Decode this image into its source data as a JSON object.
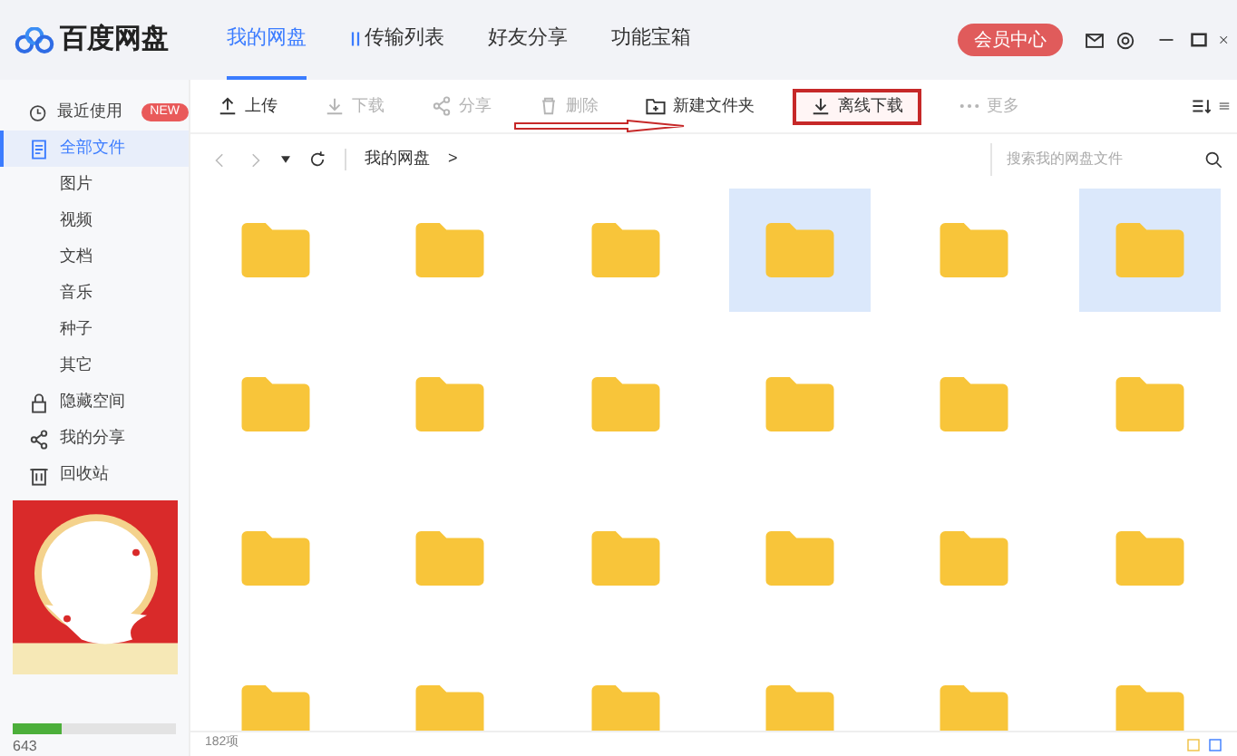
{
  "app": {
    "name": "百度网盘"
  },
  "nav_tabs": [
    {
      "label": "我的网盘",
      "selected": true,
      "kind": "plain"
    },
    {
      "label": "传输列表",
      "selected": false,
      "kind": "transfer"
    },
    {
      "label": "好友分享",
      "selected": false,
      "kind": "plain"
    },
    {
      "label": "功能宝箱",
      "selected": false,
      "kind": "plain"
    }
  ],
  "vip_button": "会员中心",
  "sidebar": {
    "items": [
      {
        "label": "最近使用",
        "kind": "recent",
        "badge": "NEW",
        "selected": false
      },
      {
        "label": "全部文件",
        "kind": "all",
        "selected": true
      },
      {
        "label": "图片",
        "kind": "sub",
        "selected": false
      },
      {
        "label": "视频",
        "kind": "sub",
        "selected": false
      },
      {
        "label": "文档",
        "kind": "sub",
        "selected": false
      },
      {
        "label": "音乐",
        "kind": "sub",
        "selected": false
      },
      {
        "label": "种子",
        "kind": "sub",
        "selected": false
      },
      {
        "label": "其它",
        "kind": "sub",
        "selected": false
      },
      {
        "label": "隐藏空间",
        "kind": "lock",
        "selected": false
      },
      {
        "label": "我的分享",
        "kind": "share",
        "selected": false
      },
      {
        "label": "回收站",
        "kind": "trash",
        "selected": false
      }
    ],
    "storage": {
      "level": 0.3,
      "text": "643"
    }
  },
  "toolbar": [
    {
      "label": "上传",
      "kind": "upload",
      "disabled": false,
      "highlighted": false
    },
    {
      "label": "下载",
      "kind": "download",
      "disabled": true,
      "highlighted": false
    },
    {
      "label": "分享",
      "kind": "share",
      "disabled": true,
      "highlighted": false
    },
    {
      "label": "删除",
      "kind": "delete",
      "disabled": true,
      "highlighted": false
    },
    {
      "label": "新建文件夹",
      "kind": "folder",
      "disabled": false,
      "highlighted": false
    },
    {
      "label": "离线下载",
      "kind": "download",
      "disabled": false,
      "highlighted": true
    },
    {
      "label": "更多",
      "kind": "more",
      "disabled": true,
      "highlighted": false
    }
  ],
  "breadcrumb": {
    "path": "我的网盘",
    "separator": ">"
  },
  "search": {
    "placeholder": "搜索我的网盘文件"
  },
  "folders": [
    {
      "selected": false
    },
    {
      "selected": false
    },
    {
      "selected": false
    },
    {
      "selected": true
    },
    {
      "selected": false
    },
    {
      "selected": true
    },
    {
      "selected": false
    },
    {
      "selected": false
    },
    {
      "selected": false
    },
    {
      "selected": false
    },
    {
      "selected": false
    },
    {
      "selected": false
    },
    {
      "selected": false
    },
    {
      "selected": false
    },
    {
      "selected": false
    },
    {
      "selected": false
    },
    {
      "selected": false
    },
    {
      "selected": false
    },
    {
      "selected": false
    },
    {
      "selected": false
    },
    {
      "selected": false
    },
    {
      "selected": false
    },
    {
      "selected": false
    },
    {
      "selected": false
    }
  ],
  "status_bar": {
    "count": "182项"
  }
}
